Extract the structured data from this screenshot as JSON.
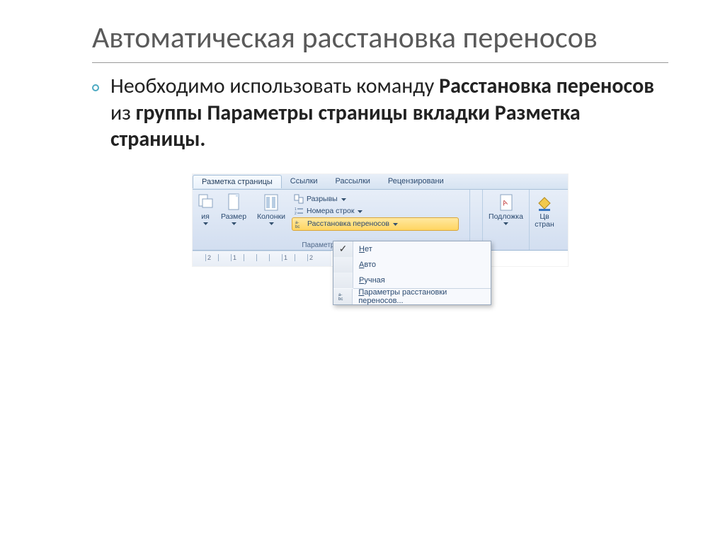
{
  "slide": {
    "title": "Автоматическая расстановка переносов",
    "body_prefix": "Необходимо использовать команду ",
    "body_bold1": "Расстановка переносов",
    "body_mid": " из ",
    "body_bold2": "группы Параметры страницы вкладки Разметка страницы.",
    "tabs": {
      "active": "Разметка страницы",
      "t1": "Ссылки",
      "t2": "Рассылки",
      "t3": "Рецензировани"
    },
    "ribbon": {
      "btn_orient_suffix": "ия",
      "btn_size": "Размер",
      "btn_columns": "Колонки",
      "row_breaks": "Разрывы",
      "row_line_numbers": "Номера строк",
      "row_hyphen": "Расстановка переносов",
      "group_page_setup": "Параметры стран",
      "btn_watermark": "Подложка",
      "btn_color_line1": "Цв",
      "btn_color_line2": "стран"
    },
    "dropdown": {
      "none_u": "Н",
      "none_rest": "ет",
      "auto_u": "А",
      "auto_rest": "вто",
      "manual_u": "Р",
      "manual_rest": "учная",
      "params_u": "П",
      "params_rest": "араметры расстановки переносов..."
    }
  }
}
